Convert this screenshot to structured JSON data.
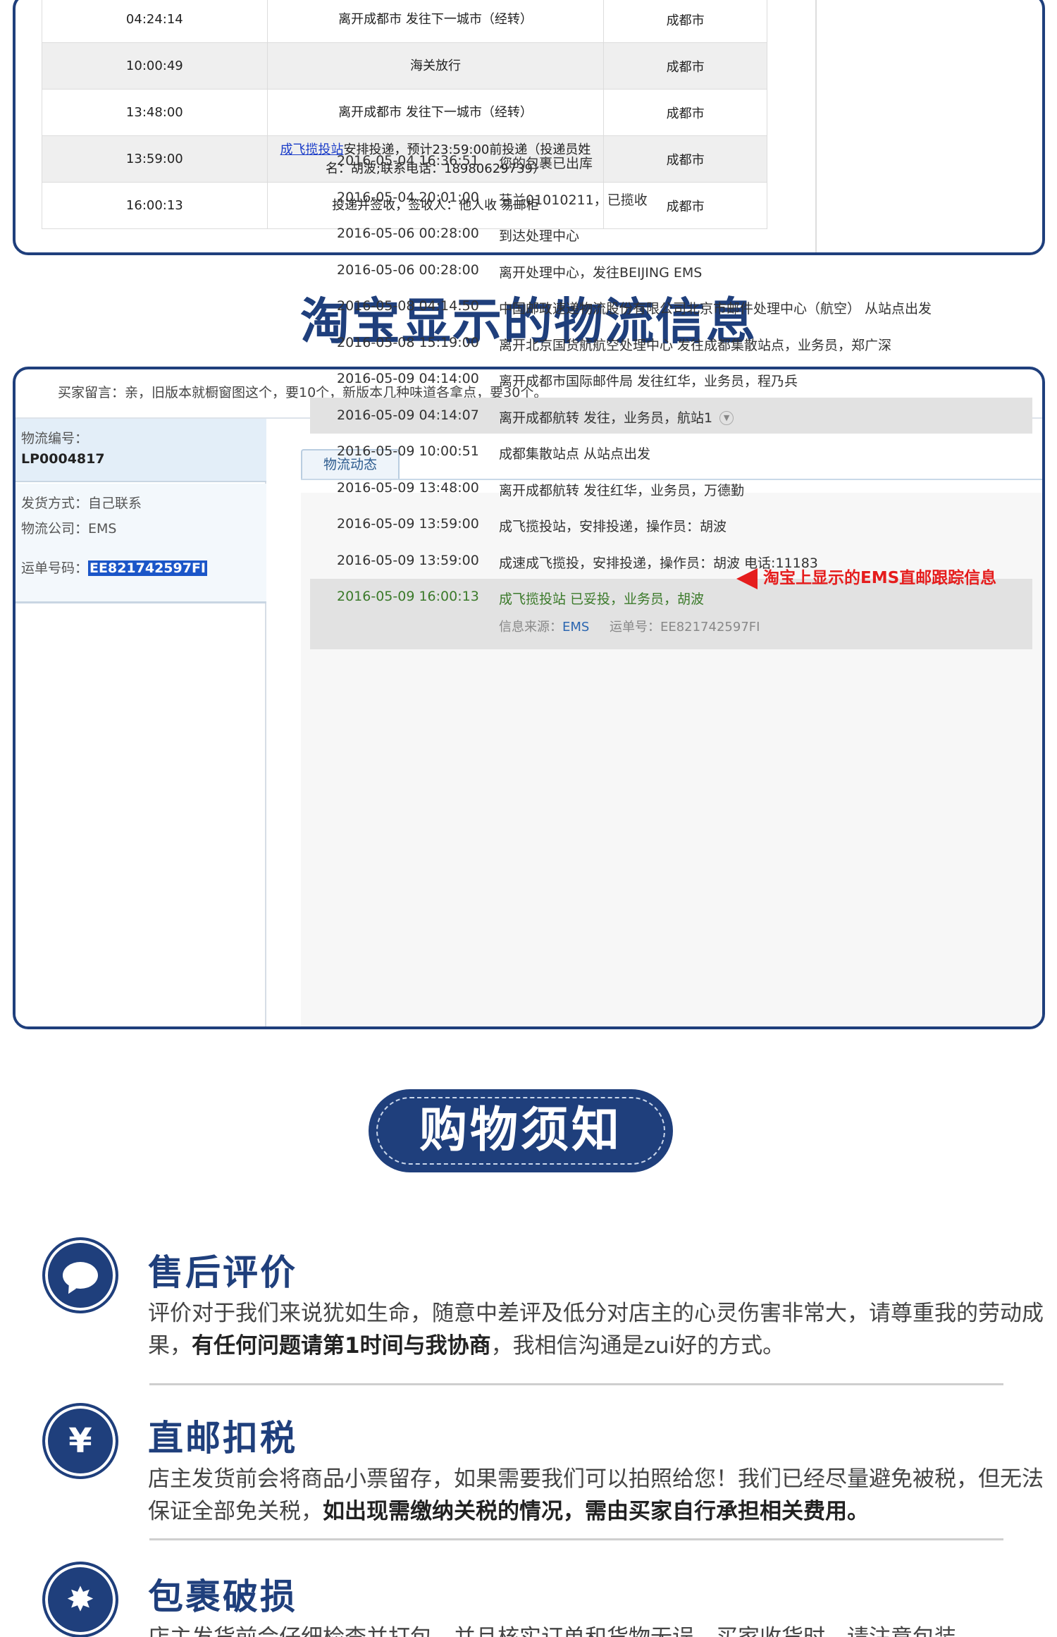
{
  "ems_table": {
    "rows": [
      {
        "time": "04:24:14",
        "event": "离开成都市 发往下一城市（经转）",
        "city": "成都市"
      },
      {
        "time": "10:00:49",
        "event": "海关放行",
        "city": "成都市"
      },
      {
        "time": "13:48:00",
        "event": "离开成都市 发往下一城市（经转）",
        "city": "成都市"
      },
      {
        "time": "13:59:00",
        "event_link": "成飞揽投站",
        "event_rest": "安排投递，预计23:59:00前投递（投递员姓名：胡波;联系电话：18980629739）",
        "city": "成都市"
      },
      {
        "time": "16:00:13",
        "event": "投递并签收，签收人：他人收 易邮柜",
        "city": "成都市"
      }
    ]
  },
  "section_title": "淘宝显示的物流信息",
  "taobao": {
    "buyer_message": "买家留言：亲，旧版本就橱窗图这个，要10个，新版本几种味道各拿点，要30个。",
    "logistics_no_label": "物流编号：",
    "logistics_no": "LP0004817",
    "ship_method": "发货方式：自己联系",
    "company": "物流公司：EMS",
    "waybill_label": "运单号码：",
    "waybill_no": "EE821742597FI",
    "tab_label": "物流动态",
    "annotation": "淘宝上显示的EMS直邮跟踪信息",
    "events": [
      {
        "time": "2016-05-04 16:36:51",
        "text": "您的包裹已出库"
      },
      {
        "time": "2016-05-04 20:01:00",
        "text": "芬兰01010211，已揽收"
      },
      {
        "time": "2016-05-06 00:28:00",
        "text": "到达处理中心"
      },
      {
        "time": "2016-05-06 00:28:00",
        "text": "离开处理中心，发往BEIJING EMS"
      },
      {
        "time": "2016-05-08 04:14:50",
        "text": "中国邮政速递物流股份有限公司北京市邮件处理中心（航空） 从站点出发"
      },
      {
        "time": "2016-05-08 15:19:00",
        "text": "离开北京国货航航空处理中心 发往成都集散站点，业务员，郑广深"
      },
      {
        "time": "2016-05-09 04:14:00",
        "text": "离开成都市国际邮件局 发往红华，业务员，程乃兵"
      },
      {
        "time": "2016-05-09 04:14:07",
        "text": "离开成都航转 发往，业务员，航站1"
      },
      {
        "time": "2016-05-09 10:00:51",
        "text": "成都集散站点 从站点出发"
      },
      {
        "time": "2016-05-09 13:48:00",
        "text": "离开成都航转 发往红华，业务员，万德勤"
      },
      {
        "time": "2016-05-09 13:59:00",
        "text": "成飞揽投站，安排投递，操作员：胡波"
      },
      {
        "time": "2016-05-09 13:59:00",
        "text": "成速成飞揽投，安排投递，操作员：胡波 电话:11183"
      },
      {
        "time": "2016-05-09 16:00:13",
        "text": "成飞揽投站 已妥投，业务员，胡波"
      }
    ],
    "source_label": "信息来源：",
    "source_value": "EMS",
    "footer_waybill": "运单号：EE821742597FI"
  },
  "notice_title": "购物须知",
  "notice_items": [
    {
      "icon": "speech-bubble-icon",
      "title": "售后评价",
      "text_a": "评价对于我们来说犹如生命，随意中差评及低分对店主的心灵伤害非常大，请尊重我的劳动成果，",
      "text_b": "有任何问题请第1时间与我协商",
      "text_c": "，我相信沟通是zui好的方式。"
    },
    {
      "icon": "yen-icon",
      "icon_glyph": "¥",
      "title": "直邮扣税",
      "text_a": "店主发货前会将商品小票留存，如果需要我们可以拍照给您！我们已经尽量避免被税，但无法保证全部免关税，",
      "text_b": "如出现需缴纳关税的情况，需由买家自行承担相关费用。",
      "text_c": ""
    },
    {
      "icon": "burst-icon",
      "icon_glyph": "✸",
      "title": "包裹破损",
      "text_a": "店主发货前会仔细检查并打包，并且核实订单和货物无误，买家收货时，请注意包装",
      "text_b": "",
      "text_c": ""
    }
  ]
}
